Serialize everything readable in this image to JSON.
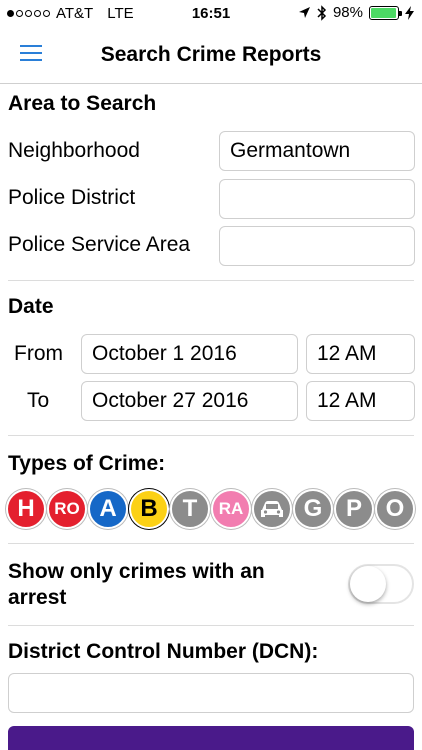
{
  "status_bar": {
    "carrier": "AT&T",
    "network": "LTE",
    "time": "16:51",
    "battery": "98%"
  },
  "nav": {
    "title": "Search Crime Reports",
    "menu_icon": "hamburger-menu-icon"
  },
  "area": {
    "title": "Area to Search",
    "neighborhood_label": "Neighborhood",
    "neighborhood_value": "Germantown",
    "district_label": "Police District",
    "district_value": "",
    "psa_label": "Police Service Area",
    "psa_value": ""
  },
  "date": {
    "title": "Date",
    "from_label": "From",
    "from_date": "October 1 2016",
    "from_time": "12 AM",
    "to_label": "To",
    "to_date": "October 27 2016",
    "to_time": "12 AM"
  },
  "crime_types": {
    "title": "Types of Crime:",
    "badges": [
      {
        "label": "H",
        "color": "#e4202e"
      },
      {
        "label": "RO",
        "color": "#e4202e"
      },
      {
        "label": "A",
        "color": "#1668c7"
      },
      {
        "label": "B",
        "color": "#fcd116"
      },
      {
        "label": "T",
        "color": "#8c8c8c"
      },
      {
        "label": "RA",
        "color": "#f27db0"
      },
      {
        "label": "car-icon",
        "color": "#8c8c8c"
      },
      {
        "label": "G",
        "color": "#8c8c8c"
      },
      {
        "label": "P",
        "color": "#8c8c8c"
      },
      {
        "label": "O",
        "color": "#8c8c8c"
      }
    ]
  },
  "arrest": {
    "label_line1": "Show only crimes with an",
    "label_line2": "arrest",
    "enabled": false
  },
  "dcn": {
    "title": "District Control Number (DCN):",
    "value": ""
  },
  "colors": {
    "accent": "#2a7fd8",
    "button": "#4a1a8a"
  }
}
